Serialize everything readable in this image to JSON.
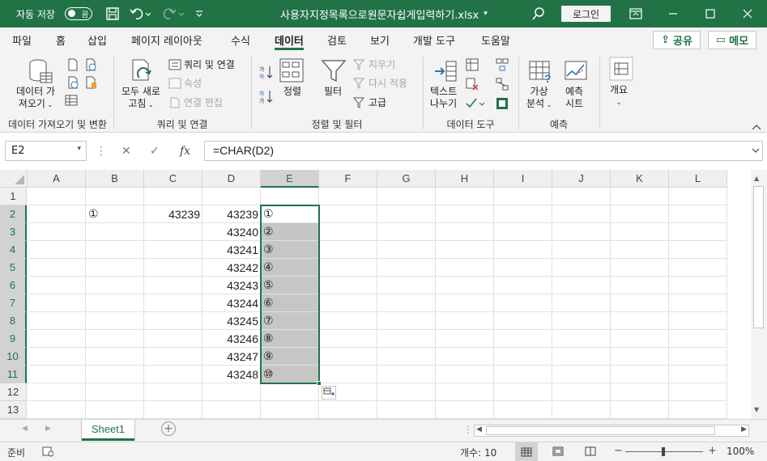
{
  "titlebar": {
    "autosave_label": "자동 저장",
    "autosave_state": "끔",
    "filename": "사용자지정목록으로원문자쉽게입력하기.xlsx",
    "login_label": "로그인"
  },
  "menu": {
    "tabs": [
      "파일",
      "홈",
      "삽입",
      "페이지 레이아웃",
      "수식",
      "데이터",
      "검토",
      "보기",
      "개발 도구",
      "도움말"
    ],
    "active_tab": "데이터",
    "share_label": "공유",
    "memo_label": "메모"
  },
  "ribbon": {
    "get_data_line1": "데이터 가",
    "get_data_line2": "져오기",
    "refresh_all_line1": "모두 새로",
    "refresh_all_line2": "고침",
    "queries_connections": "쿼리 및 연결",
    "properties": "속성",
    "edit_links": "연결 편집",
    "sort_label": "정렬",
    "filter_label": "필터",
    "clear_label": "지우기",
    "reapply_label": "다시 적용",
    "advanced_label": "고급",
    "text_to_columns_line1": "텍스트",
    "text_to_columns_line2": "나누기",
    "whatif_line1": "가상",
    "whatif_line2": "분석",
    "forecast_line1": "예측",
    "forecast_line2": "시트",
    "outline_label": "개요",
    "group_get_transform": "데이터 가져오기 및 변환",
    "group_queries": "쿼리 및 연결",
    "group_sort_filter": "정렬 및 필터",
    "group_data_tools": "데이터 도구",
    "group_forecast": "예측"
  },
  "formula_bar": {
    "name_box": "E2",
    "formula": "=CHAR(D2)",
    "fx_label": "fx"
  },
  "grid": {
    "columns": [
      "A",
      "B",
      "C",
      "D",
      "E",
      "F",
      "G",
      "H",
      "I",
      "J",
      "K",
      "L"
    ],
    "selected_column": "E",
    "rows": [
      "1",
      "2",
      "3",
      "4",
      "5",
      "6",
      "7",
      "8",
      "9",
      "10",
      "11",
      "12",
      "13"
    ],
    "cells": {
      "B2": "①",
      "C2": "43239",
      "D": [
        "43239",
        "43240",
        "43241",
        "43242",
        "43243",
        "43244",
        "43245",
        "43246",
        "43247",
        "43248"
      ],
      "E": [
        "①",
        "②",
        "③",
        "④",
        "⑤",
        "⑥",
        "⑦",
        "⑧",
        "⑨",
        "⑩"
      ]
    }
  },
  "sheets": {
    "tabs": [
      "Sheet1"
    ],
    "active": "Sheet1"
  },
  "status": {
    "ready": "준비",
    "count_label": "개수: 10",
    "zoom": "100%",
    "accent": "#217346"
  }
}
